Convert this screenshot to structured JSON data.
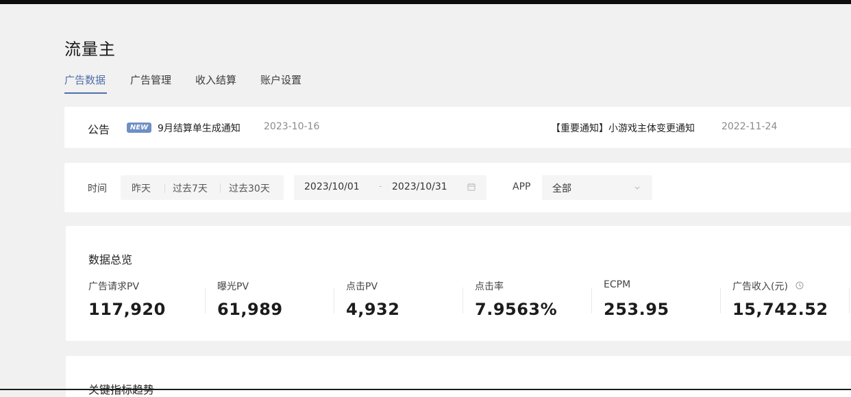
{
  "page": {
    "title": "流量主"
  },
  "tabs": [
    {
      "label": "广告数据",
      "active": true
    },
    {
      "label": "广告管理",
      "active": false
    },
    {
      "label": "收入结算",
      "active": false
    },
    {
      "label": "账户设置",
      "active": false
    }
  ],
  "notice": {
    "label": "公告",
    "badge": "NEW",
    "items": [
      {
        "text": "9月结算单生成通知",
        "date": "2023-10-16"
      },
      {
        "text": "【重要通知】小游戏主体变更通知",
        "date": "2022-11-24"
      }
    ]
  },
  "filters": {
    "time_label": "时间",
    "quick_options": [
      "昨天",
      "过去7天",
      "过去30天"
    ],
    "start_date": "2023/10/01",
    "separator": "-",
    "end_date": "2023/10/31",
    "app_label": "APP",
    "app_value": "全部"
  },
  "overview": {
    "title": "数据总览",
    "metrics": [
      {
        "label": "广告请求PV",
        "value": "117,920"
      },
      {
        "label": "曝光PV",
        "value": "61,989"
      },
      {
        "label": "点击PV",
        "value": "4,932"
      },
      {
        "label": "点击率",
        "value": "7.9563%"
      },
      {
        "label": "ECPM",
        "value": "253.95"
      },
      {
        "label": "广告收入(元)",
        "value": "15,742.52",
        "icon": "info-icon"
      }
    ]
  },
  "trend": {
    "title": "关键指标趋势"
  },
  "icons": {
    "calendar": "calendar-icon",
    "dropdown": "chevron-down-icon",
    "info": "info-icon"
  },
  "colors": {
    "accent": "#4f6ea8",
    "badge": "#6f8fc4",
    "background": "#f1f1f2"
  }
}
